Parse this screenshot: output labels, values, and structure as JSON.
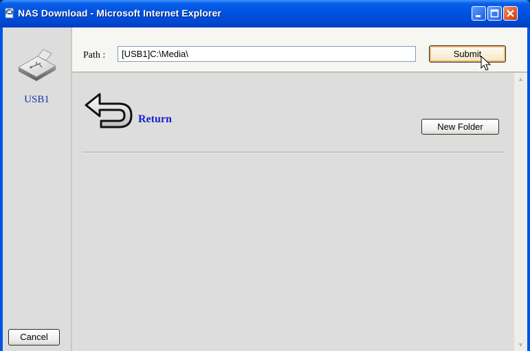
{
  "window": {
    "title": "NAS Download - Microsoft Internet Explorer",
    "buttons": {
      "minimize": "minimize",
      "maximize": "maximize",
      "close": "close"
    }
  },
  "sidebar": {
    "device_label": "USB1",
    "device_icon": "usb-drive-icon",
    "cancel_label": "Cancel"
  },
  "path_bar": {
    "label": "Path :",
    "value": "[USB1]C:\\Media\\",
    "submit_label": "Submit"
  },
  "content": {
    "return_label": "Return",
    "return_icon": "return-arrow-icon",
    "new_folder_label": "New Folder"
  },
  "scrollbar": {
    "up": "▲",
    "down": "▼"
  }
}
